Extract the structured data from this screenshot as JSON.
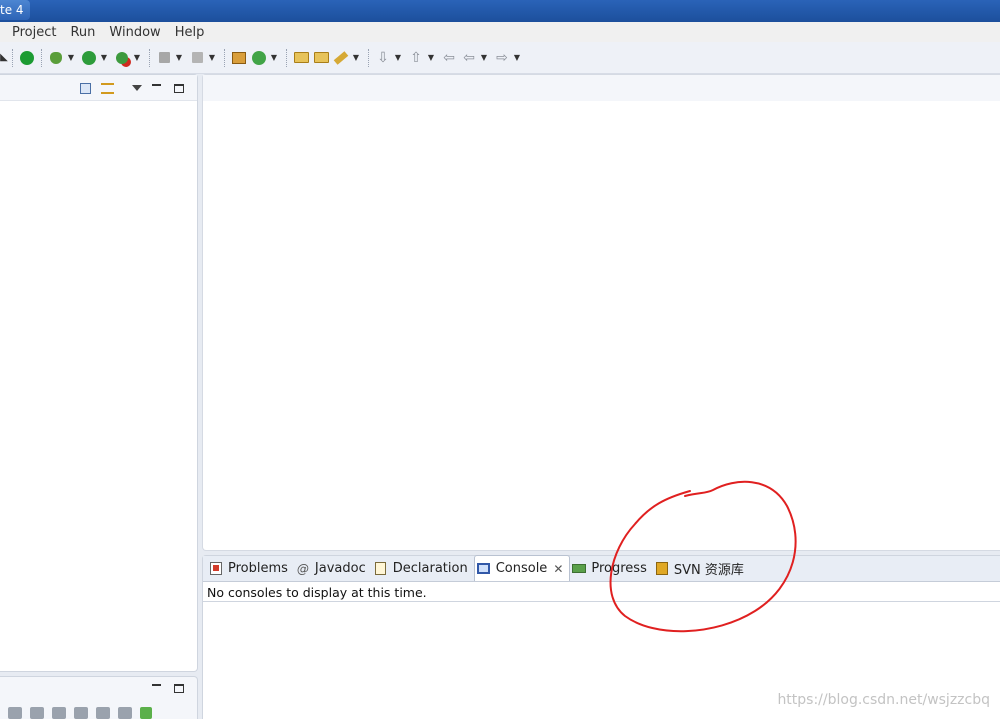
{
  "window": {
    "title": "te 4"
  },
  "menubar": {
    "items": [
      "Project",
      "Run",
      "Window",
      "Help"
    ]
  },
  "toolbar": {
    "icons": [
      "power-icon",
      "debug-icon",
      "run-icon",
      "external-tools-icon",
      "stop-icon",
      "generic-icon",
      "package-icon",
      "new-class-icon",
      "open-folder-icon",
      "open-folder-2-icon",
      "edit-icon",
      "next-annotation-icon",
      "prev-annotation-icon",
      "back-icon",
      "previous-icon",
      "forward-icon"
    ]
  },
  "bottom_panel": {
    "tabs": [
      {
        "label": "Problems",
        "icon": "problems-icon"
      },
      {
        "label": "Javadoc",
        "icon": "at-icon"
      },
      {
        "label": "Declaration",
        "icon": "declaration-icon"
      },
      {
        "label": "Console",
        "icon": "console-icon",
        "active": true
      },
      {
        "label": "Progress",
        "icon": "progress-icon"
      },
      {
        "label": "SVN 资源库",
        "icon": "svn-icon"
      }
    ],
    "console_message": "No consoles to display at this time."
  },
  "watermark": "https://blog.csdn.net/wsjzzcbq",
  "colors": {
    "annotation": "#e02020",
    "titlebar": "#1c4f9c"
  }
}
